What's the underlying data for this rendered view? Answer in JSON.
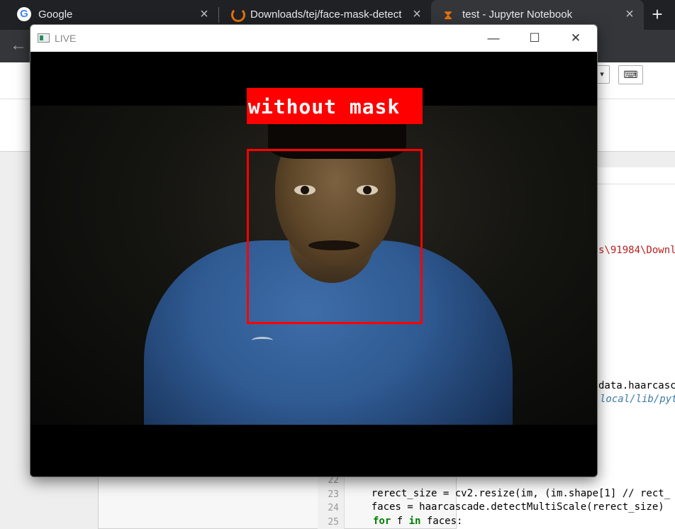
{
  "browser": {
    "tabs": [
      {
        "title": "Google",
        "icon": "google-icon"
      },
      {
        "title": "Downloads/tej/face-mask-detect",
        "icon": "loading-icon"
      },
      {
        "title": "test - Jupyter Notebook",
        "icon": "hourglass-icon"
      }
    ],
    "close_glyph": "×",
    "newtab_glyph": "+",
    "back_glyph": "←"
  },
  "notebook": {
    "string_fragment": "s\\91984\\Downl",
    "attr_fragment": "data.haarcasca",
    "italic_fragment": "local/lib/pyt",
    "lines": [
      {
        "num": "22",
        "text": ""
      },
      {
        "num": "23",
        "text": "    rerect_size = cv2.resize(im, (im.shape[1] // rect_"
      },
      {
        "num": "24",
        "text": "    faces = haarcascade.detectMultiScale(rerect_size)"
      },
      {
        "num": "25",
        "keyword1": "for",
        "mid": " f ",
        "keyword2": "in",
        "rest": " faces:"
      }
    ]
  },
  "live_window": {
    "title": "LIVE",
    "minimize_glyph": "—",
    "maximize_glyph": "☐",
    "close_glyph": "✕",
    "detection": {
      "label": "without mask",
      "box_color": "#ff0000",
      "label_text_color": "#ffffff"
    }
  }
}
